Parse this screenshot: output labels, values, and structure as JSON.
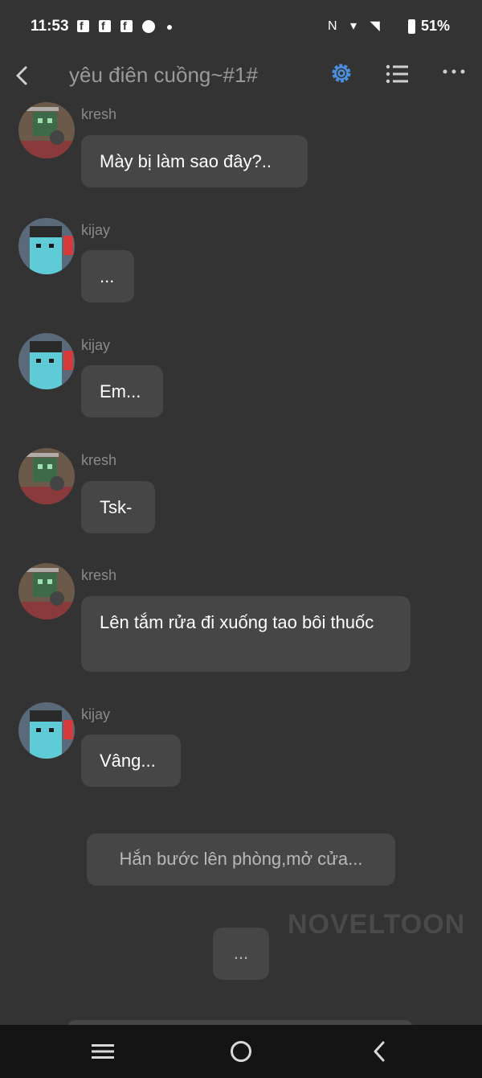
{
  "status_bar": {
    "time": "11:53",
    "notification_icons": [
      "facebook-icon",
      "facebook-icon",
      "facebook-icon",
      "messenger-icon"
    ],
    "battery": "51%"
  },
  "header": {
    "title": "yêu điên cuồng~#1#",
    "accent_color": "#4a90e2"
  },
  "messages": [
    {
      "sender": "kresh",
      "text": "Mày bị làm sao đây?.."
    },
    {
      "sender": "kijay",
      "text": "..."
    },
    {
      "sender": "kijay",
      "text": "Em..."
    },
    {
      "sender": "kresh",
      "text": "Tsk-"
    },
    {
      "sender": "kresh",
      "text": "Lên tắm rửa đi xuống tao bôi thuốc"
    },
    {
      "sender": "kijay",
      "text": "Vâng..."
    }
  ],
  "narrations": [
    {
      "text": "Hắn bước lên phòng,mở cửa..."
    },
    {
      "text": "..."
    }
  ],
  "watermark": "NOVELTOON"
}
